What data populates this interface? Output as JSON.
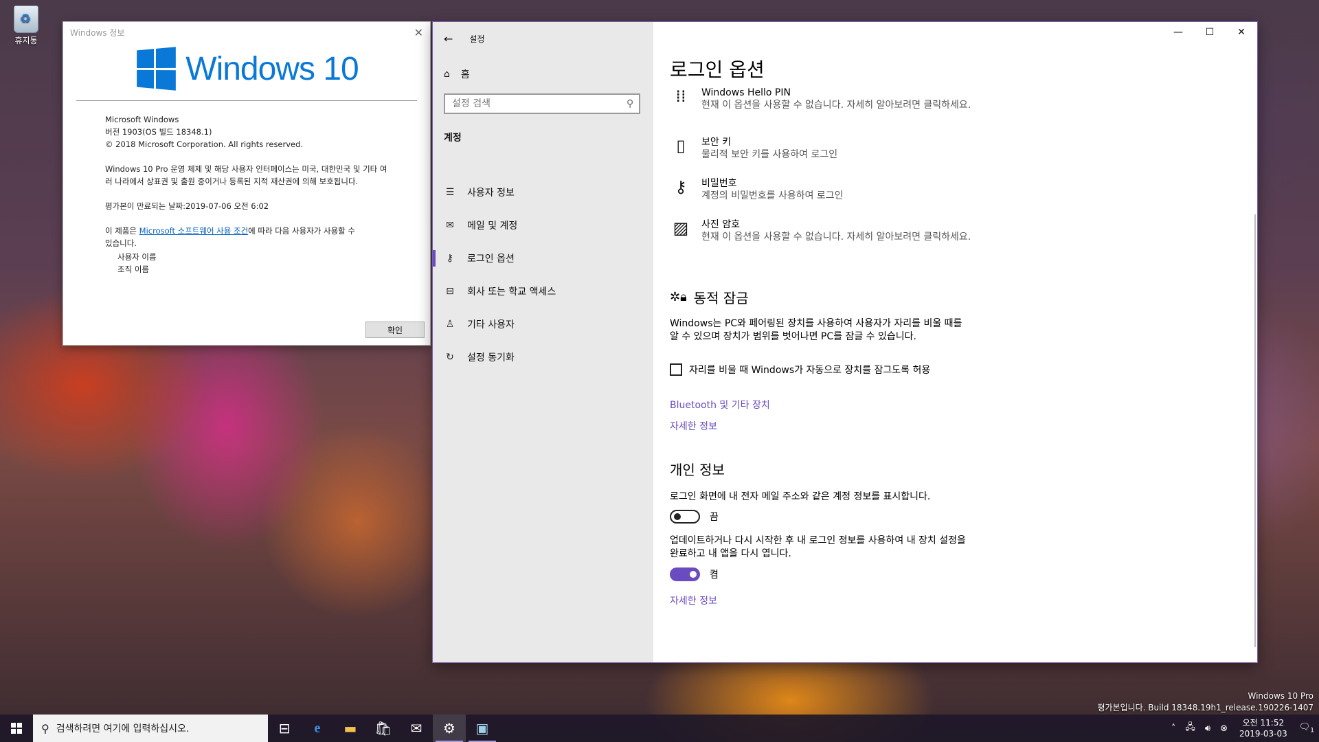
{
  "desktop": {
    "recycle_bin_label": "휴지통",
    "watermark_line1": "Windows 10 Pro",
    "watermark_line2": "평가본입니다. Build 18348.19h1_release.190226-1407"
  },
  "about": {
    "title": "Windows 정보",
    "logo_text": "Windows 10",
    "product": "Microsoft Windows",
    "version": "버전 1903(OS 빌드 18348.1)",
    "copyright": "© 2018 Microsoft Corporation. All rights reserved.",
    "legal": "Windows 10 Pro 운영 체제 및 해당 사용자 인터페이스는 미국, 대한민국 및 기타 여러 나라에서 상표권 및 출원 중이거나 등록된 지적 재산권에 의해 보호됩니다.",
    "expiry": "평가본이 만료되는 날짜:2019-07-06 오전 6:02",
    "license_pre": "이 제품은 ",
    "license_link": "Microsoft 소프트웨어 사용 조건",
    "license_post": "에 따라 다음 사용자가 사용할 수 있습니다.",
    "user_name": "사용자 이름",
    "org_name": "조직 이름",
    "ok_label": "확인"
  },
  "settings": {
    "window_title": "설정",
    "home_label": "홈",
    "search_placeholder": "설정 검색",
    "section_heading": "계정",
    "nav": [
      {
        "label": "사용자 정보"
      },
      {
        "label": "메일 및 계정"
      },
      {
        "label": "로그인 옵션"
      },
      {
        "label": "회사 또는 학교 액세스"
      },
      {
        "label": "기타 사용자"
      },
      {
        "label": "설정 동기화"
      }
    ],
    "page_title": "로그인 옵션",
    "options": [
      {
        "title": "Windows Hello PIN",
        "desc": "현재 이 옵션을 사용할 수 없습니다. 자세히 알아보려면 클릭하세요."
      },
      {
        "title": "보안 키",
        "desc": "물리적 보안 키를 사용하여 로그인"
      },
      {
        "title": "비밀번호",
        "desc": "계정의 비밀번호를 사용하여 로그인"
      },
      {
        "title": "사진 암호",
        "desc": "현재 이 옵션을 사용할 수 없습니다. 자세히 알아보려면 클릭하세요."
      }
    ],
    "dynamic_lock": {
      "heading": "동적 잠금",
      "description": "Windows는 PC와 페어링된 장치를 사용하여 사용자가 자리를 비울 때를 알 수 있으며 장치가 범위를 벗어나면 PC를 잠글 수 있습니다.",
      "checkbox_label": "자리를 비울 때 Windows가 자동으로 장치를 잠그도록 허용",
      "link_bluetooth": "Bluetooth 및 기타 장치",
      "link_more": "자세한 정보"
    },
    "privacy": {
      "heading": "개인 정보",
      "setting1": "로그인 화면에 내 전자 메일 주소와 같은 계정 정보를 표시합니다.",
      "toggle1_state": "끔",
      "setting2": "업데이트하거나 다시 시작한 후 내 로그인 정보를 사용하여 내 장치 설정을 완료하고 내 앱을 다시 엽니다.",
      "toggle2_state": "켬",
      "link_more": "자세한 정보"
    }
  },
  "taskbar": {
    "search_placeholder": "검색하려면 여기에 입력하십시오.",
    "time": "오전 11:52",
    "date": "2019-03-03",
    "notification_count": "1"
  },
  "colors": {
    "accent": "#6b4bc0",
    "windows_blue": "#0a78d7"
  }
}
